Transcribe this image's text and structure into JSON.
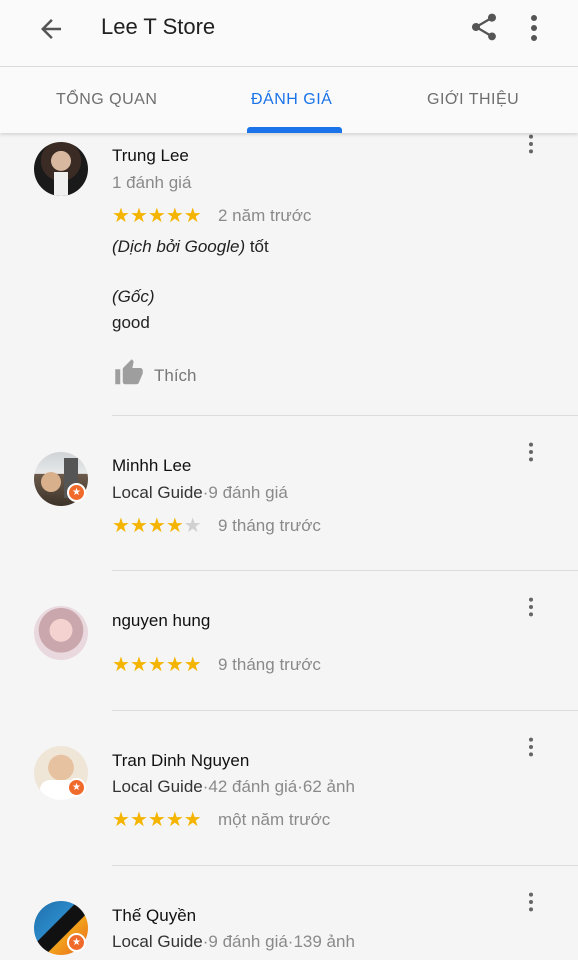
{
  "appbar": {
    "title": "Lee T Store",
    "back_icon": "arrow-left-icon",
    "share_icon": "share-icon",
    "more_icon": "more-vert-icon"
  },
  "tabs": [
    {
      "label": "TỔNG QUAN",
      "active": false
    },
    {
      "label": "ĐÁNH GIÁ",
      "active": true
    },
    {
      "label": "GIỚI THIỆU",
      "active": false
    }
  ],
  "colors": {
    "accent": "#1a73e8",
    "star": "#f4b400",
    "star_off": "#d0d0d0",
    "local_guide_badge": "#f06a2c"
  },
  "reviews": [
    {
      "name": "Trung Lee",
      "meta": "1 đánh giá",
      "rating": 5,
      "time": "2 năm trước",
      "translated_label": "(Dịch bởi Google)",
      "translated_text": " tốt",
      "original_label": "(Gốc)",
      "original_text": "good",
      "like_label": "Thích"
    },
    {
      "name": "Minhh Lee",
      "guide": "Local Guide",
      "meta": "·9 đánh giá",
      "rating": 4,
      "time": "9 tháng trước"
    },
    {
      "name": "nguyen hung",
      "rating": 5,
      "time": "9 tháng trước"
    },
    {
      "name": "Tran Dinh Nguyen",
      "guide": "Local Guide",
      "meta": "·42 đánh giá·62 ảnh",
      "rating": 5,
      "time": "một năm trước"
    },
    {
      "name": "Thế Quyền",
      "guide": "Local Guide",
      "meta": "·9 đánh giá·139 ảnh"
    }
  ]
}
